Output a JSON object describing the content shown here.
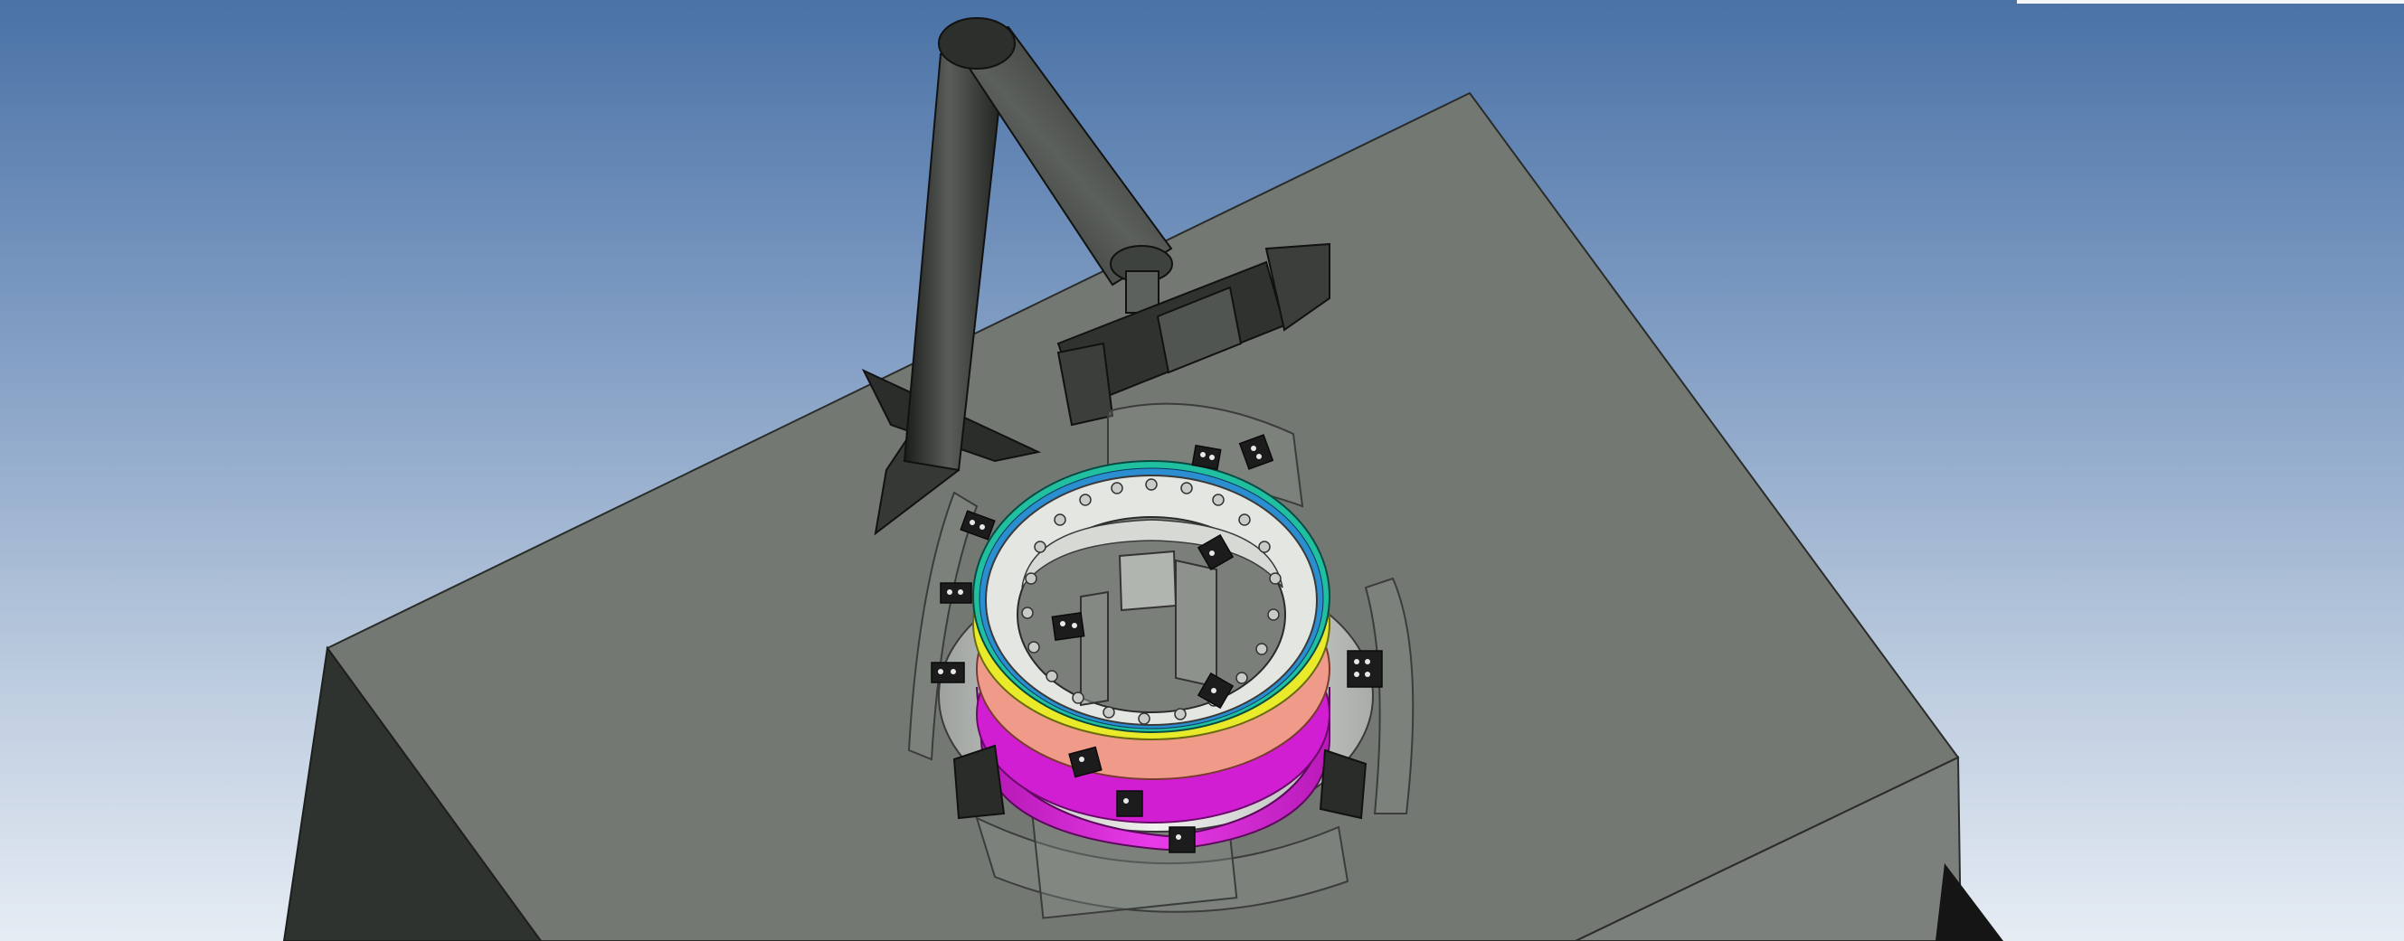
{
  "viewer": {
    "kind": "3D CAD viewport",
    "background_top": "#4a72a6",
    "background_bottom": "#e6ecf4"
  },
  "colors": {
    "platform_top": "#737873",
    "platform_left": "#2f332f",
    "platform_right": "#7c807c",
    "arm": "#3a3d3a",
    "ring_green": "#1fbfa0",
    "ring_yellow": "#e8ea2a",
    "ring_salmon": "#f09a8a",
    "ring_magenta": "#d21ed2",
    "ring_steel": "#d8dbd6",
    "fixture_glass": "#8c918c",
    "clamp": "#1c1c1c"
  },
  "icons": [
    "camera-fixture-icon",
    "clamp-icon"
  ]
}
